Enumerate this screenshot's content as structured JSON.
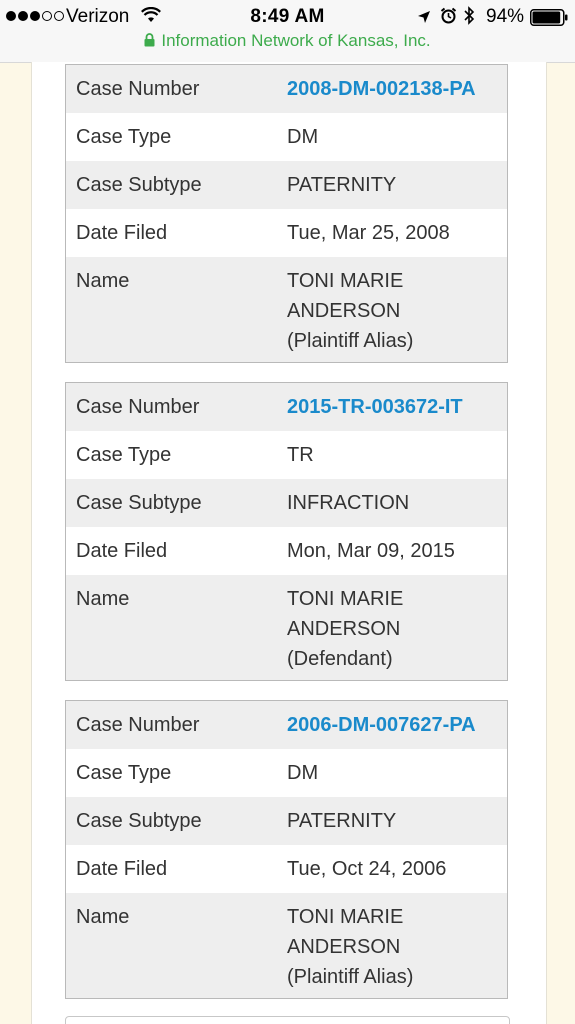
{
  "status_bar": {
    "carrier": "Verizon",
    "time": "8:49 AM",
    "battery_percent": "94%",
    "signal_bars_filled": 3,
    "signal_bars_total": 5,
    "battery_level": 0.94
  },
  "browser": {
    "site_label": "Information Network of Kansas, Inc.",
    "secure_color": "#3dab4c"
  },
  "labels": {
    "case_number": "Case Number",
    "case_type": "Case Type",
    "case_subtype": "Case Subtype",
    "date_filed": "Date Filed",
    "name": "Name"
  },
  "cases": [
    {
      "case_number": "2008-DM-002138-PA",
      "case_type": "DM",
      "case_subtype": "PATERNITY",
      "date_filed": "Tue, Mar 25, 2008",
      "name_line1": "TONI MARIE",
      "name_line2": "ANDERSON",
      "name_role": "(Plaintiff Alias)"
    },
    {
      "case_number": "2015-TR-003672-IT",
      "case_type": "TR",
      "case_subtype": "INFRACTION",
      "date_filed": "Mon, Mar 09, 2015",
      "name_line1": "TONI MARIE",
      "name_line2": "ANDERSON",
      "name_role": "(Defendant)"
    },
    {
      "case_number": "2006-DM-007627-PA",
      "case_type": "DM",
      "case_subtype": "PATERNITY",
      "date_filed": "Tue, Oct 24, 2006",
      "name_line1": "TONI MARIE",
      "name_line2": "ANDERSON",
      "name_role": "(Plaintiff Alias)"
    }
  ],
  "colors": {
    "link": "#1a8acb",
    "row_shade": "#eeeeee",
    "page_background": "#fdf8e7"
  }
}
